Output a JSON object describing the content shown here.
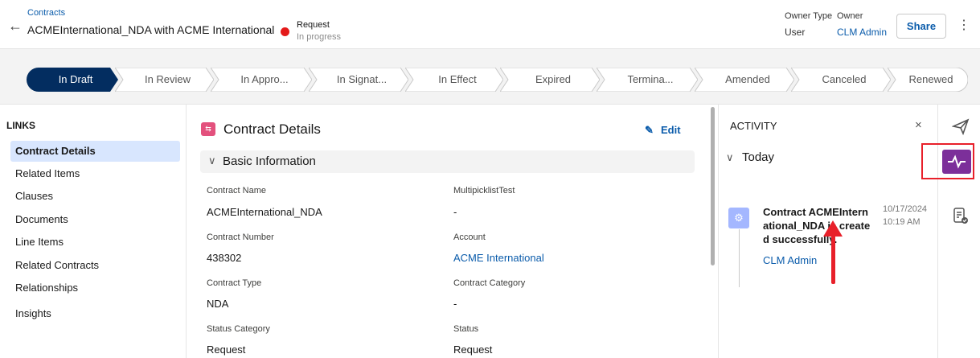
{
  "header": {
    "breadcrumb": "Contracts",
    "title": "ACMEInternational_NDA  with  ACME International",
    "status_main": "Request",
    "status_sub": "In progress",
    "owner_type_label": "Owner Type",
    "owner_type_value": "User",
    "owner_label": "Owner",
    "owner_value": "CLM Admin",
    "share_label": "Share",
    "more_icon": "⋮",
    "back_icon": "←"
  },
  "path": {
    "stages": [
      {
        "label": "In Draft",
        "active": true
      },
      {
        "label": "In Review",
        "active": false
      },
      {
        "label": "In Appro...",
        "active": false
      },
      {
        "label": "In Signat...",
        "active": false
      },
      {
        "label": "In Effect",
        "active": false
      },
      {
        "label": "Expired",
        "active": false
      },
      {
        "label": "Termina...",
        "active": false
      },
      {
        "label": "Amended",
        "active": false
      },
      {
        "label": "Canceled",
        "active": false
      },
      {
        "label": "Renewed",
        "active": false
      }
    ],
    "active_color": "#032d60"
  },
  "leftnav": {
    "title": "LINKS",
    "items": [
      {
        "label": "Contract Details",
        "active": true
      },
      {
        "label": "Related Items",
        "active": false
      },
      {
        "label": "Clauses",
        "active": false
      },
      {
        "label": "Documents",
        "active": false
      },
      {
        "label": "Line Items",
        "active": false
      },
      {
        "label": "Related Contracts",
        "active": false
      },
      {
        "label": "Relationships",
        "active": false
      },
      {
        "label": "Insights",
        "active": false
      }
    ]
  },
  "main": {
    "title": "Contract Details",
    "edit_label": "Edit",
    "section_label": "Basic Information",
    "fields": [
      {
        "label": "Contract Name",
        "value": "ACMEInternational_NDA",
        "link": false
      },
      {
        "label": "MultipicklistTest",
        "value": "-",
        "link": false
      },
      {
        "label": "Contract Number",
        "value": "438302",
        "link": false
      },
      {
        "label": "Account",
        "value": "ACME International",
        "link": true
      },
      {
        "label": "Contract Type",
        "value": "NDA",
        "link": false
      },
      {
        "label": "Contract Category",
        "value": "-",
        "link": false
      },
      {
        "label": "Status Category",
        "value": "Request",
        "link": false
      },
      {
        "label": "Status",
        "value": "Request",
        "link": false
      }
    ]
  },
  "activity": {
    "title": "ACTIVITY",
    "close_icon": "×",
    "group_label": "Today",
    "entry_text": "Contract ACMEInternational_NDA is created successfully.",
    "entry_user": "CLM Admin",
    "entry_date": "10/17/2024",
    "entry_time": "10:19 AM"
  },
  "colors": {
    "accent": "#0b5cab",
    "highlight": "#e8202a",
    "activity_active": "#7c2f9a"
  }
}
